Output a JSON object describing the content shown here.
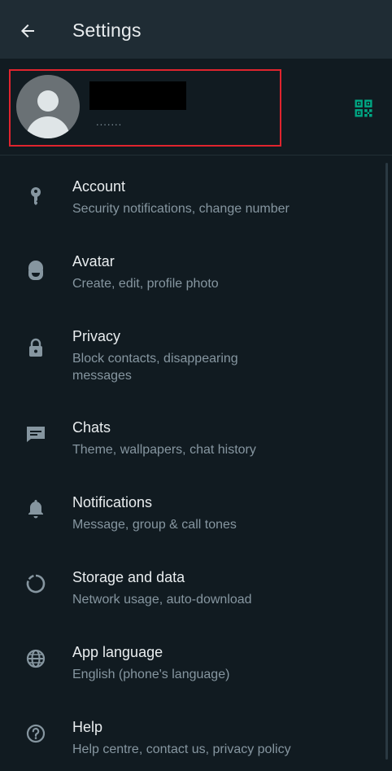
{
  "header": {
    "title": "Settings",
    "back_icon": "arrow-left-icon"
  },
  "profile": {
    "name": "",
    "status": ".......",
    "qr_icon": "qr-code-icon",
    "qr_color": "#00a884"
  },
  "menu": {
    "items": [
      {
        "title": "Account",
        "subtitle": "Security notifications, change number",
        "icon": "key-icon"
      },
      {
        "title": "Avatar",
        "subtitle": "Create, edit, profile photo",
        "icon": "avatar-face-icon"
      },
      {
        "title": "Privacy",
        "subtitle": "Block contacts, disappearing messages",
        "icon": "lock-icon"
      },
      {
        "title": "Chats",
        "subtitle": "Theme, wallpapers, chat history",
        "icon": "chat-icon"
      },
      {
        "title": "Notifications",
        "subtitle": "Message, group & call tones",
        "icon": "bell-icon"
      },
      {
        "title": "Storage and data",
        "subtitle": "Network usage, auto-download",
        "icon": "storage-circle-icon"
      },
      {
        "title": "App language",
        "subtitle": "English (phone's language)",
        "icon": "globe-icon"
      },
      {
        "title": "Help",
        "subtitle": "Help centre, contact us, privacy policy",
        "icon": "help-circle-icon"
      }
    ]
  },
  "colors": {
    "background": "#111b21",
    "appbar": "#1f2c34",
    "accent": "#00a884",
    "text_primary": "#e9edef",
    "text_secondary": "#8696a0",
    "highlight_border": "#e0242e"
  }
}
